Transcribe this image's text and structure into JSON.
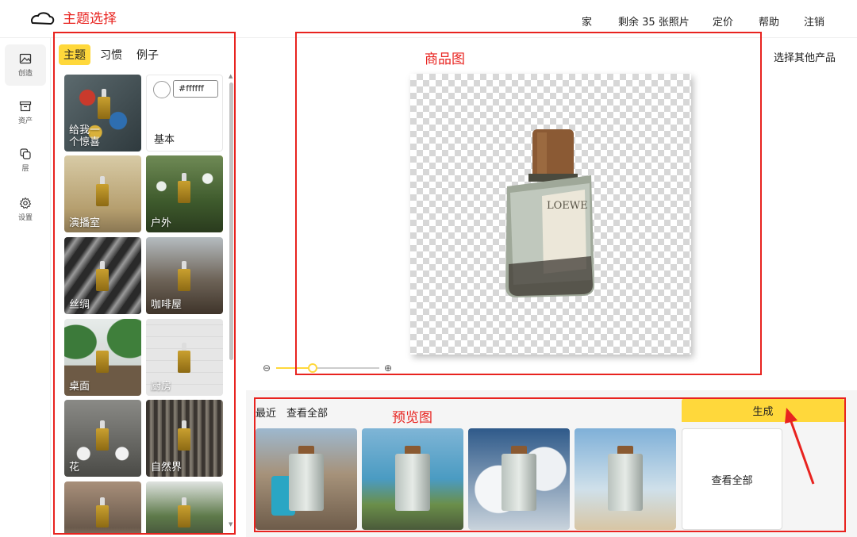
{
  "topbar": {
    "nav": [
      "家",
      "剩余 35 张照片",
      "定价",
      "帮助",
      "注销"
    ]
  },
  "rail": {
    "items": [
      {
        "label": "创造",
        "icon": "image-icon"
      },
      {
        "label": "资产",
        "icon": "archive-icon"
      },
      {
        "label": "层",
        "icon": "layers-icon"
      },
      {
        "label": "设置",
        "icon": "gear-icon"
      }
    ]
  },
  "panel": {
    "tabs": [
      "主题",
      "习惯",
      "例子"
    ],
    "active_tab": "主题",
    "basic": {
      "hex": "#ffffff",
      "label": "基本"
    },
    "cards": [
      "给我一\n个惊喜",
      "演播室",
      "户外",
      "丝绸",
      "咖啡屋",
      "桌面",
      "厨房",
      "花",
      "自然界"
    ]
  },
  "canvas": {
    "choose_other": "选择其他产品",
    "product_brand": "LOEWE",
    "zoom_level": 0.35
  },
  "preview": {
    "recent": "最近",
    "view_all": "查看全部",
    "generate": "生成",
    "view_all_card": "查看全部"
  },
  "annotations": {
    "theme": "主题选择",
    "product": "商品图",
    "preview": "预览图"
  },
  "colors": {
    "accent": "#ffd83b",
    "annotation": "#e8231f"
  }
}
